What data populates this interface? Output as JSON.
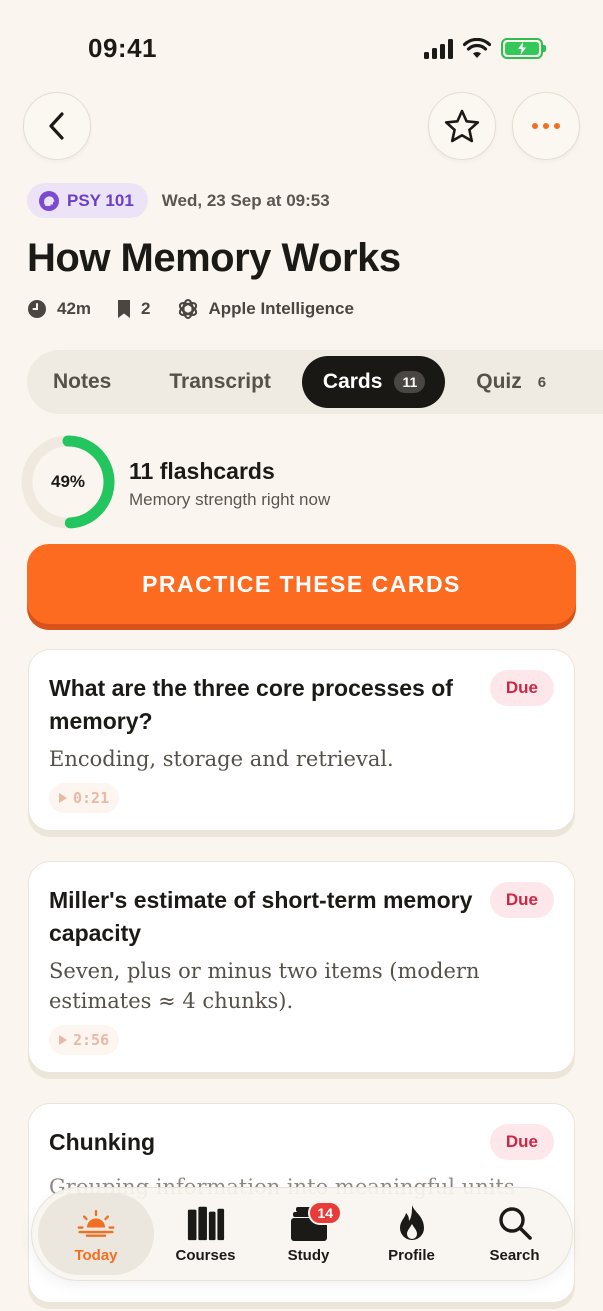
{
  "status": {
    "time": "09:41"
  },
  "header": {
    "course": "PSY 101",
    "date": "Wed, 23 Sep at 09:53",
    "title": "How Memory Works"
  },
  "stats": {
    "duration": "42m",
    "bookmarks": "2",
    "ai_label": "Apple Intelligence"
  },
  "tabs": [
    {
      "label": "Notes"
    },
    {
      "label": "Transcript"
    },
    {
      "label": "Cards",
      "count": "11"
    },
    {
      "label": "Quiz",
      "count": "6"
    }
  ],
  "summary": {
    "strength_percent": 49,
    "strength_label": "49%",
    "title": "11 flashcards",
    "subtitle": "Memory strength right now"
  },
  "practice_label": "PRACTICE THESE CARDS",
  "cards": [
    {
      "question": "What are the three core processes of memory?",
      "answer": "Encoding, storage and retrieval.",
      "status": "Due",
      "timestamp": "0:21"
    },
    {
      "question": "Miller's estimate of short-term memory capacity",
      "answer": "Seven, plus or minus two items (modern estimates ≈ 4 chunks).",
      "status": "Due",
      "timestamp": "2:56"
    },
    {
      "question": "Chunking",
      "answer": "Grouping information into meaningful units to",
      "status": "Due"
    }
  ],
  "nav": [
    {
      "label": "Today",
      "icon": "sunrise-icon"
    },
    {
      "label": "Courses",
      "icon": "books-icon"
    },
    {
      "label": "Study",
      "icon": "cards-stack-icon",
      "badge": "14"
    },
    {
      "label": "Profile",
      "icon": "flame-icon"
    },
    {
      "label": "Search",
      "icon": "search-icon"
    }
  ],
  "colors": {
    "accent": "#fd6b21",
    "ring": "#22c55e",
    "due": "#cc2745",
    "course": "#6b3fc8"
  }
}
